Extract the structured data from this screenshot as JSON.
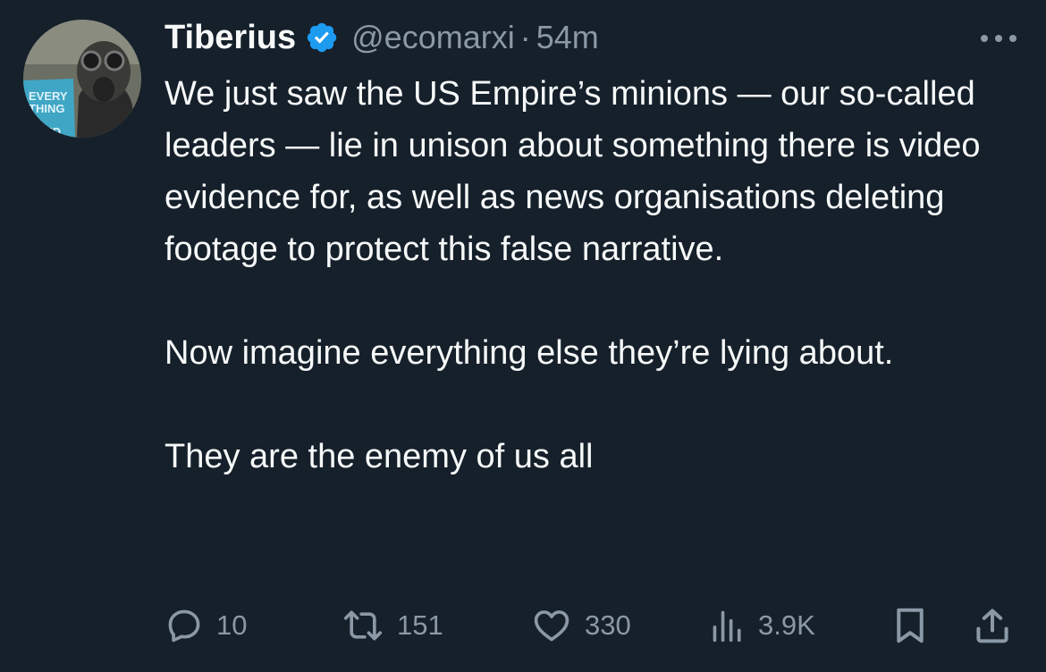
{
  "tweet": {
    "author": {
      "name": "Tiberius",
      "handle": "@ecomarxi",
      "verified": true,
      "avatar_book_text": [
        "EVERY",
        "THING",
        "SKED"
      ]
    },
    "separator": "·",
    "time": "54m",
    "paragraphs": [
      "We just saw the US Empire’s minions — our so-called leaders — lie in unison about something there is video evidence for, as well as news organisations deleting footage to protect this false narrative.",
      "Now imagine everything else they’re lying about.",
      "They are the enemy of us all"
    ],
    "actions": {
      "replies": "10",
      "retweets": "151",
      "likes": "330",
      "views": "3.9K"
    },
    "icons": {
      "verified": "verified-badge-icon",
      "more": "more-icon",
      "reply": "reply-icon",
      "retweet": "retweet-icon",
      "like": "heart-icon",
      "views": "views-chart-icon",
      "bookmark": "bookmark-icon",
      "share": "share-icon"
    },
    "colors": {
      "background": "#15202b",
      "text": "#f7f9f9",
      "secondary": "#8b98a5",
      "verified": "#1d9bf0"
    }
  }
}
